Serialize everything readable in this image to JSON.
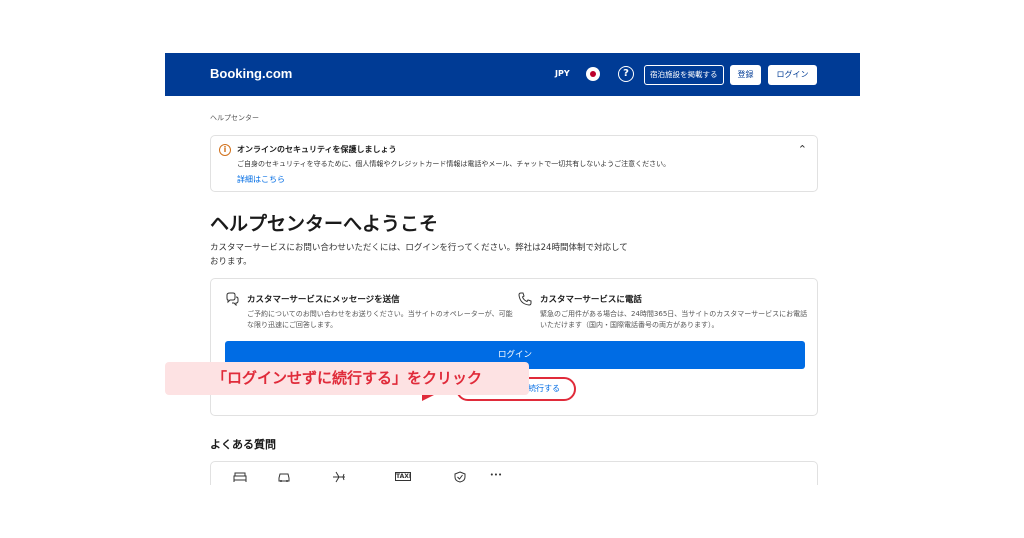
{
  "header": {
    "logo": "Booking.com",
    "currency": "JPY",
    "list_property": "宿泊施設を掲載する",
    "register": "登録",
    "login": "ログイン"
  },
  "breadcrumb": "ヘルプセンター",
  "alert": {
    "title": "オンラインのセキュリティを保護しましょう",
    "body": "ご自身のセキュリティを守るために、個人情報やクレジットカード情報は電話やメール、チャットで一切共有しないようご注意ください。",
    "link": "詳細はこちら"
  },
  "welcome": {
    "title": "ヘルプセンターへようこそ",
    "intro": "カスタマーサービスにお問い合わせいただくには、ログインを行ってください。弊社は24時間体制で対応しております。"
  },
  "contact": {
    "message": {
      "title": "カスタマーサービスにメッセージを送信",
      "desc": "ご予約についてのお問い合わせをお送りください。当サイトのオペレーターが、可能な限り迅速にご回答します。"
    },
    "phone": {
      "title": "カスタマーサービスに電話",
      "desc": "緊急のご用件がある場合は、24時間365日、当サイトのカスタマーサービスにお電話いただけます（国内・国際電話番号の両方があります）。"
    },
    "login_button": "ログイン",
    "continue_link": "ログインせずに続行する"
  },
  "annotation": "「ログインせずに続行する」をクリック",
  "faq": {
    "title": "よくある質問",
    "taxi_label": "TAXI",
    "more_label": "•••"
  },
  "colors": {
    "brand": "#003b95",
    "primary": "#006ce4",
    "highlight": "#e02b3a",
    "annotation_bg": "#fde2e3"
  }
}
